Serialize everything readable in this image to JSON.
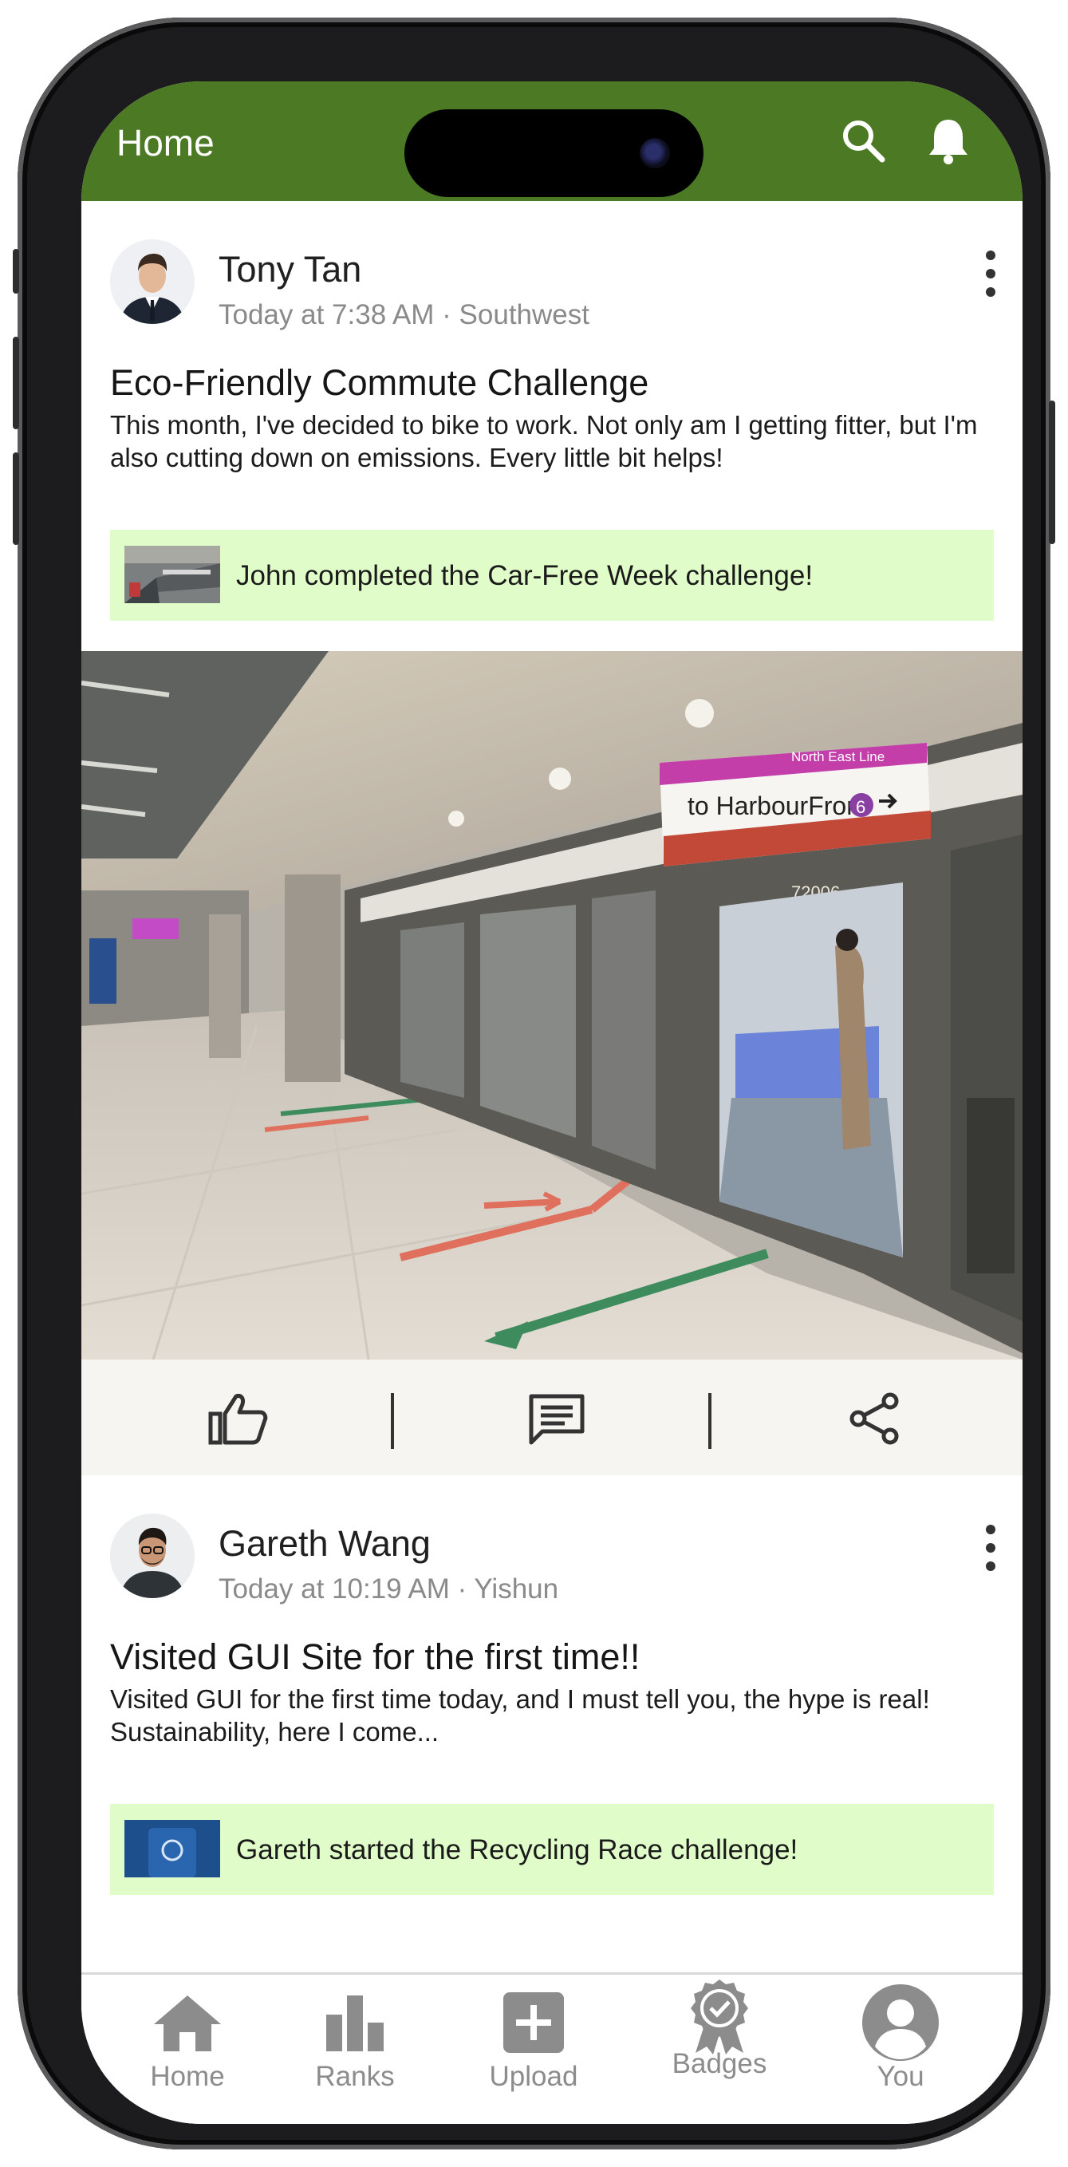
{
  "appbar": {
    "title": "Home",
    "color": "#4c7a24",
    "icons": [
      "search-icon",
      "bell-icon"
    ]
  },
  "posts": [
    {
      "author": "Tony Tan",
      "meta": "Today at 7:38 AM · Southwest",
      "title": "Eco-Friendly Commute Challenge",
      "body": "This month, I've decided to bike to work. Not only am I getting fitter, but I'm also cutting down on emissions. Every little bit helps!",
      "banner": "John completed the Car-Free Week challenge!"
    },
    {
      "author": "Gareth Wang",
      "meta": "Today at 10:19 AM · Yishun",
      "title": "Visited GUI Site for the first time!!",
      "body": "Visited GUI for the first time today, and I must tell you, the hype is real! Sustainability, here I come...",
      "banner": "Gareth started the Recycling Race challenge!"
    }
  ],
  "photo": {
    "sign_line": "North East Line",
    "sign_dest": "to HarbourFront",
    "sign_num": "6",
    "train_no": "72006"
  },
  "actions": [
    "like-icon",
    "comment-icon",
    "share-icon"
  ],
  "nav": {
    "items": [
      {
        "label": "Home",
        "icon": "home-icon"
      },
      {
        "label": "Ranks",
        "icon": "ranks-icon"
      },
      {
        "label": "Upload",
        "icon": "upload-icon"
      },
      {
        "label": "Badges",
        "icon": "badges-icon"
      },
      {
        "label": "You",
        "icon": "profile-icon"
      }
    ]
  },
  "banner_color": "#e0fcc8"
}
